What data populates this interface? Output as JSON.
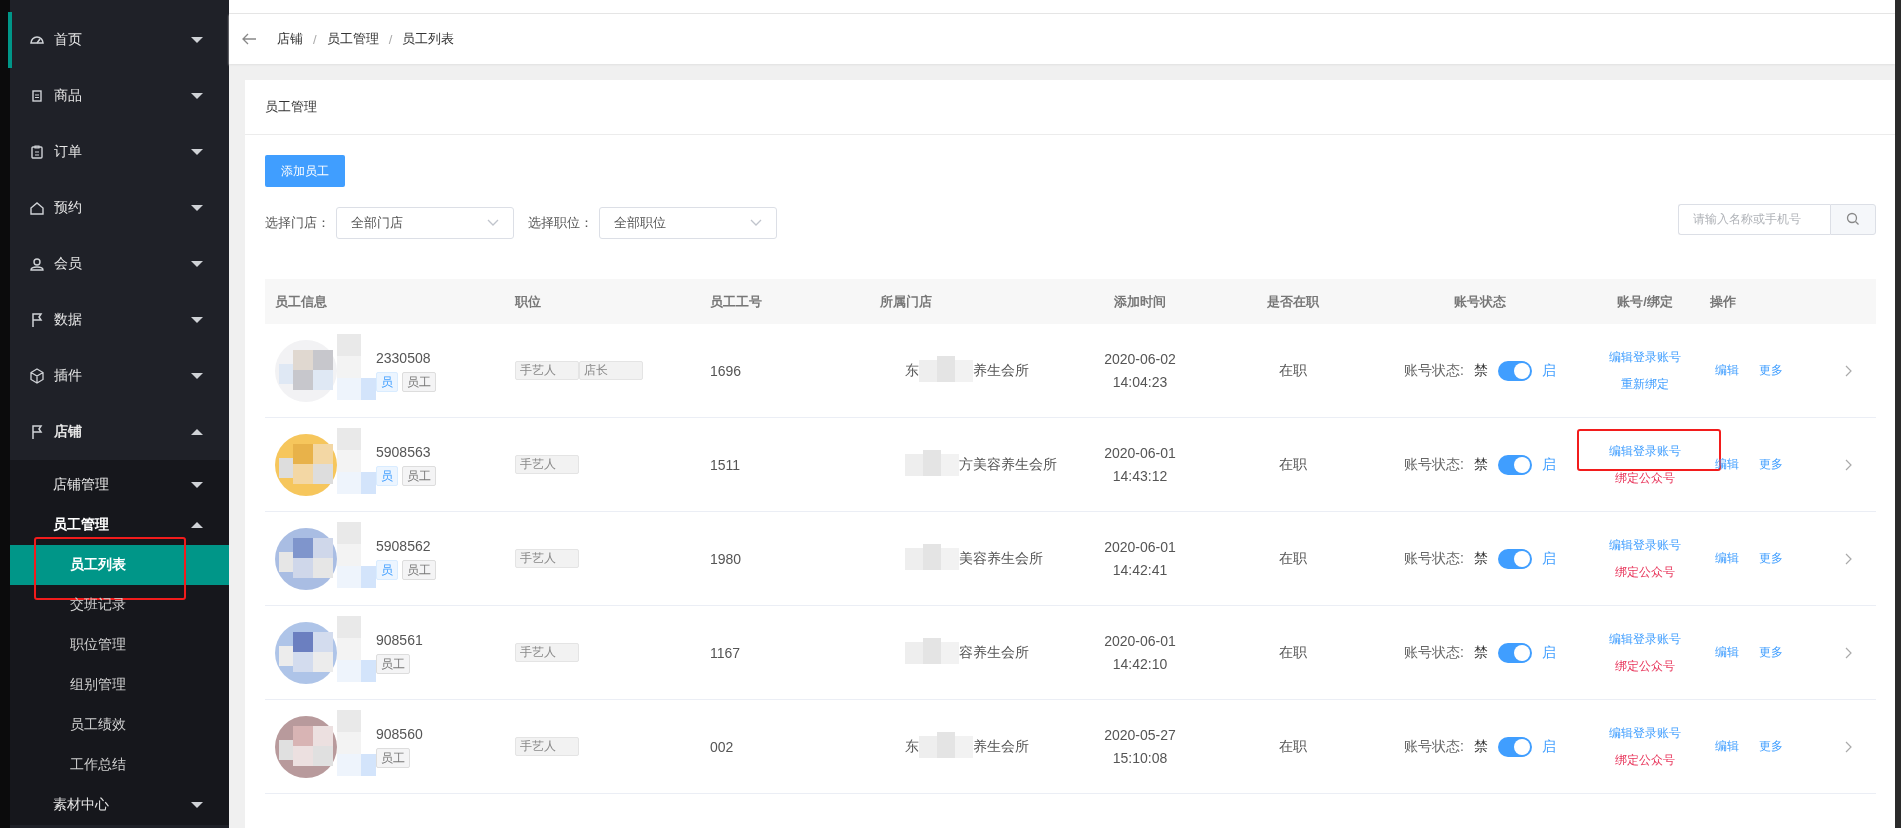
{
  "sidebar": {
    "items": [
      {
        "label": "首页",
        "selected": true,
        "expanded": false
      },
      {
        "label": "商品",
        "selected": false,
        "expanded": false
      },
      {
        "label": "订单",
        "selected": false,
        "expanded": false
      },
      {
        "label": "预约",
        "selected": false,
        "expanded": false
      },
      {
        "label": "会员",
        "selected": false,
        "expanded": false
      },
      {
        "label": "数据",
        "selected": false,
        "expanded": false
      },
      {
        "label": "插件",
        "selected": false,
        "expanded": false
      },
      {
        "label": "店铺",
        "selected": false,
        "expanded": true,
        "children": [
          {
            "label": "店铺管理",
            "expanded": false
          },
          {
            "label": "员工管理",
            "expanded": true,
            "children": [
              {
                "label": "员工列表",
                "selected": true,
                "highlighted": true
              },
              {
                "label": "交班记录",
                "selected": false,
                "highlighted": false
              },
              {
                "label": "职位管理",
                "selected": false,
                "highlighted": false
              },
              {
                "label": "组别管理",
                "selected": false,
                "highlighted": false
              },
              {
                "label": "员工绩效",
                "selected": false,
                "highlighted": false
              },
              {
                "label": "工作总结",
                "selected": false,
                "highlighted": false
              }
            ]
          },
          {
            "label": "素材中心",
            "expanded": false
          }
        ]
      }
    ]
  },
  "breadcrumb": {
    "items": [
      "店铺",
      "员工管理",
      "员工列表"
    ],
    "separator": "/"
  },
  "card": {
    "title": "员工管理",
    "add_button": "添加员工",
    "filters": [
      {
        "label": "选择门店：",
        "value": "全部门店"
      },
      {
        "label": "选择职位：",
        "value": "全部职位"
      }
    ],
    "search": {
      "placeholder": "请输入名称或手机号"
    }
  },
  "table": {
    "columns": [
      "员工信息",
      "职位",
      "员工工号",
      "所属门店",
      "添加时间",
      "是否在职",
      "账号状态",
      "账号/绑定",
      "操作"
    ],
    "rows": [
      {
        "id_fragment": "2330508",
        "tags": [
          {
            "label": "员",
            "kind": "primary"
          },
          {
            "label": "员工",
            "kind": "plain"
          }
        ],
        "positions": [
          "手艺人",
          "店长"
        ],
        "number": "1696",
        "store": {
          "prefix": "东",
          "suffix": "养生会所"
        },
        "date": "2020-06-02",
        "time": "14:04:23",
        "status": "在职",
        "account": {
          "label": "账号状态:",
          "off_label": "禁",
          "on_label": "启",
          "on": true
        },
        "binding": [
          {
            "label": "编辑登录账号",
            "kind": "link",
            "highlighted": false
          },
          {
            "label": "重新绑定",
            "kind": "link",
            "highlighted": false
          }
        ],
        "actions": [
          "编辑",
          "更多"
        ]
      },
      {
        "id_fragment": "5908563",
        "tags": [
          {
            "label": "员",
            "kind": "primary"
          },
          {
            "label": "员工",
            "kind": "plain"
          }
        ],
        "positions": [
          "手艺人"
        ],
        "number": "1511",
        "store": {
          "suffix": "方美容养生会所"
        },
        "date": "2020-06-01",
        "time": "14:43:12",
        "status": "在职",
        "account": {
          "label": "账号状态:",
          "off_label": "禁",
          "on_label": "启",
          "on": true
        },
        "binding": [
          {
            "label": "编辑登录账号",
            "kind": "link",
            "highlighted": true
          },
          {
            "label": "绑定公众号",
            "kind": "warn",
            "highlighted": false
          }
        ],
        "actions": [
          "编辑",
          "更多"
        ]
      },
      {
        "id_fragment": "5908562",
        "tags": [
          {
            "label": "员",
            "kind": "primary"
          },
          {
            "label": "员工",
            "kind": "plain"
          }
        ],
        "positions": [
          "手艺人"
        ],
        "number": "1980",
        "store": {
          "suffix": "美容养生会所"
        },
        "date": "2020-06-01",
        "time": "14:42:41",
        "status": "在职",
        "account": {
          "label": "账号状态:",
          "off_label": "禁",
          "on_label": "启",
          "on": true
        },
        "binding": [
          {
            "label": "编辑登录账号",
            "kind": "link",
            "highlighted": false
          },
          {
            "label": "绑定公众号",
            "kind": "warn",
            "highlighted": false
          }
        ],
        "actions": [
          "编辑",
          "更多"
        ]
      },
      {
        "id_fragment": "908561",
        "tags": [
          {
            "label": "员工",
            "kind": "plain"
          }
        ],
        "positions": [
          "手艺人"
        ],
        "number": "1167",
        "store": {
          "suffix": "容养生会所"
        },
        "date": "2020-06-01",
        "time": "14:42:10",
        "status": "在职",
        "account": {
          "label": "账号状态:",
          "off_label": "禁",
          "on_label": "启",
          "on": true
        },
        "binding": [
          {
            "label": "编辑登录账号",
            "kind": "link",
            "highlighted": false
          },
          {
            "label": "绑定公众号",
            "kind": "warn",
            "highlighted": false
          }
        ],
        "actions": [
          "编辑",
          "更多"
        ]
      },
      {
        "id_fragment": "908560",
        "tags": [
          {
            "label": "员工",
            "kind": "plain"
          }
        ],
        "positions": [
          "手艺人"
        ],
        "number": "002",
        "store": {
          "prefix": "东",
          "suffix": "养生会所"
        },
        "date": "2020-05-27",
        "time": "15:10:08",
        "status": "在职",
        "account": {
          "label": "账号状态:",
          "off_label": "禁",
          "on_label": "启",
          "on": true
        },
        "binding": [
          {
            "label": "编辑登录账号",
            "kind": "link",
            "highlighted": false
          },
          {
            "label": "绑定公众号",
            "kind": "warn",
            "highlighted": false
          }
        ],
        "actions": [
          "编辑",
          "更多"
        ]
      }
    ]
  }
}
